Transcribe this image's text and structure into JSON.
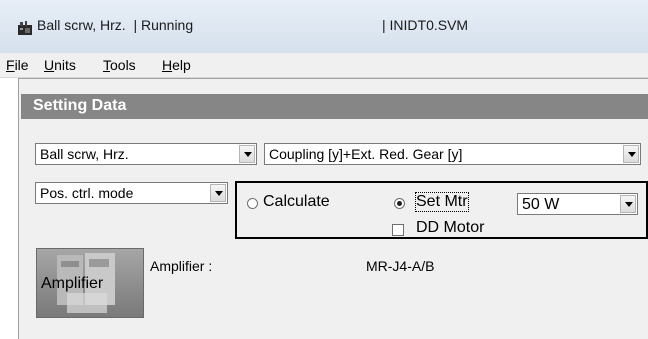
{
  "window": {
    "title": "Ball scrw, Hrz.  | Running",
    "file": "| INIDT0.SVM",
    "icon": "app-icon"
  },
  "menu": {
    "items": [
      {
        "mnemonic": "F",
        "rest": "ile"
      },
      {
        "mnemonic": "U",
        "rest": "nits"
      },
      {
        "mnemonic": "T",
        "rest": "ools"
      },
      {
        "mnemonic": "H",
        "rest": "elp"
      }
    ]
  },
  "section": {
    "title": "Setting Data"
  },
  "mechanism_combo": {
    "value": "Ball scrw, Hrz."
  },
  "coupling_combo": {
    "value": "Coupling [y]+Ext. Red. Gear [y]"
  },
  "mode_combo": {
    "value": "Pos. ctrl. mode"
  },
  "motor_group": {
    "calculate_label": "Calculate",
    "calculate_checked": false,
    "setmtr_label": "Set Mtr",
    "setmtr_checked": true,
    "dd_motor_label": "DD Motor",
    "dd_motor_checked": false,
    "capacity_value": "50 W"
  },
  "amplifier": {
    "button_label": "Amplifier",
    "field_label": "Amplifier :",
    "field_value": "MR-J4-A/B"
  },
  "colors": {
    "section_header_bg": "#868686",
    "titlebar_bg": "#dde6f1",
    "client_bg": "#f0f0f0"
  }
}
